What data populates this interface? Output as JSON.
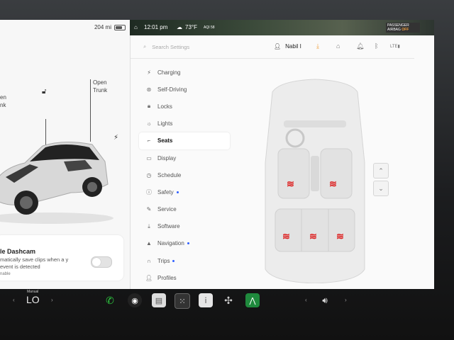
{
  "status": {
    "range": "204 mi",
    "time": "12:01 pm",
    "temp": "73°F",
    "aqi": "AQI 58",
    "airbag": {
      "line1": "PASSENGER",
      "line2": "AIRBAG",
      "state": "OFF"
    }
  },
  "car": {
    "open_frunk": [
      "en",
      "nk"
    ],
    "open_trunk": [
      "Open",
      "Trunk"
    ]
  },
  "dashcam": {
    "title": "le Dashcam",
    "desc": "matically save clips when a y event is detected",
    "enable": "nable",
    "enabled": false
  },
  "settings": {
    "search_placeholder": "Search Settings",
    "user": "Nabil I",
    "menu": [
      {
        "label": "Charging",
        "icon": "charging-bolt-icon",
        "dot": false
      },
      {
        "label": "Self-Driving",
        "icon": "steering-wheel-icon",
        "dot": false
      },
      {
        "label": "Locks",
        "icon": "lock-icon",
        "dot": false
      },
      {
        "label": "Lights",
        "icon": "lights-sun-icon",
        "dot": false
      },
      {
        "label": "Seats",
        "icon": "seat-icon",
        "dot": false
      },
      {
        "label": "Display",
        "icon": "display-icon",
        "dot": false
      },
      {
        "label": "Schedule",
        "icon": "schedule-clock-icon",
        "dot": false
      },
      {
        "label": "Safety",
        "icon": "safety-icon",
        "dot": true
      },
      {
        "label": "Service",
        "icon": "wrench-icon",
        "dot": false
      },
      {
        "label": "Software",
        "icon": "download-icon",
        "dot": false
      },
      {
        "label": "Navigation",
        "icon": "navigation-arrow-icon",
        "dot": true
      },
      {
        "label": "Trips",
        "icon": "trips-icon",
        "dot": true
      },
      {
        "label": "Profiles",
        "icon": "profile-icon",
        "dot": false
      }
    ],
    "active_item": "Seats"
  },
  "dock": {
    "climate_mode": "Manual",
    "temperature": "LO"
  },
  "colors": {
    "heat": "#dd2222",
    "accent_dot": "#3060ff",
    "orange": "#f0a040"
  }
}
